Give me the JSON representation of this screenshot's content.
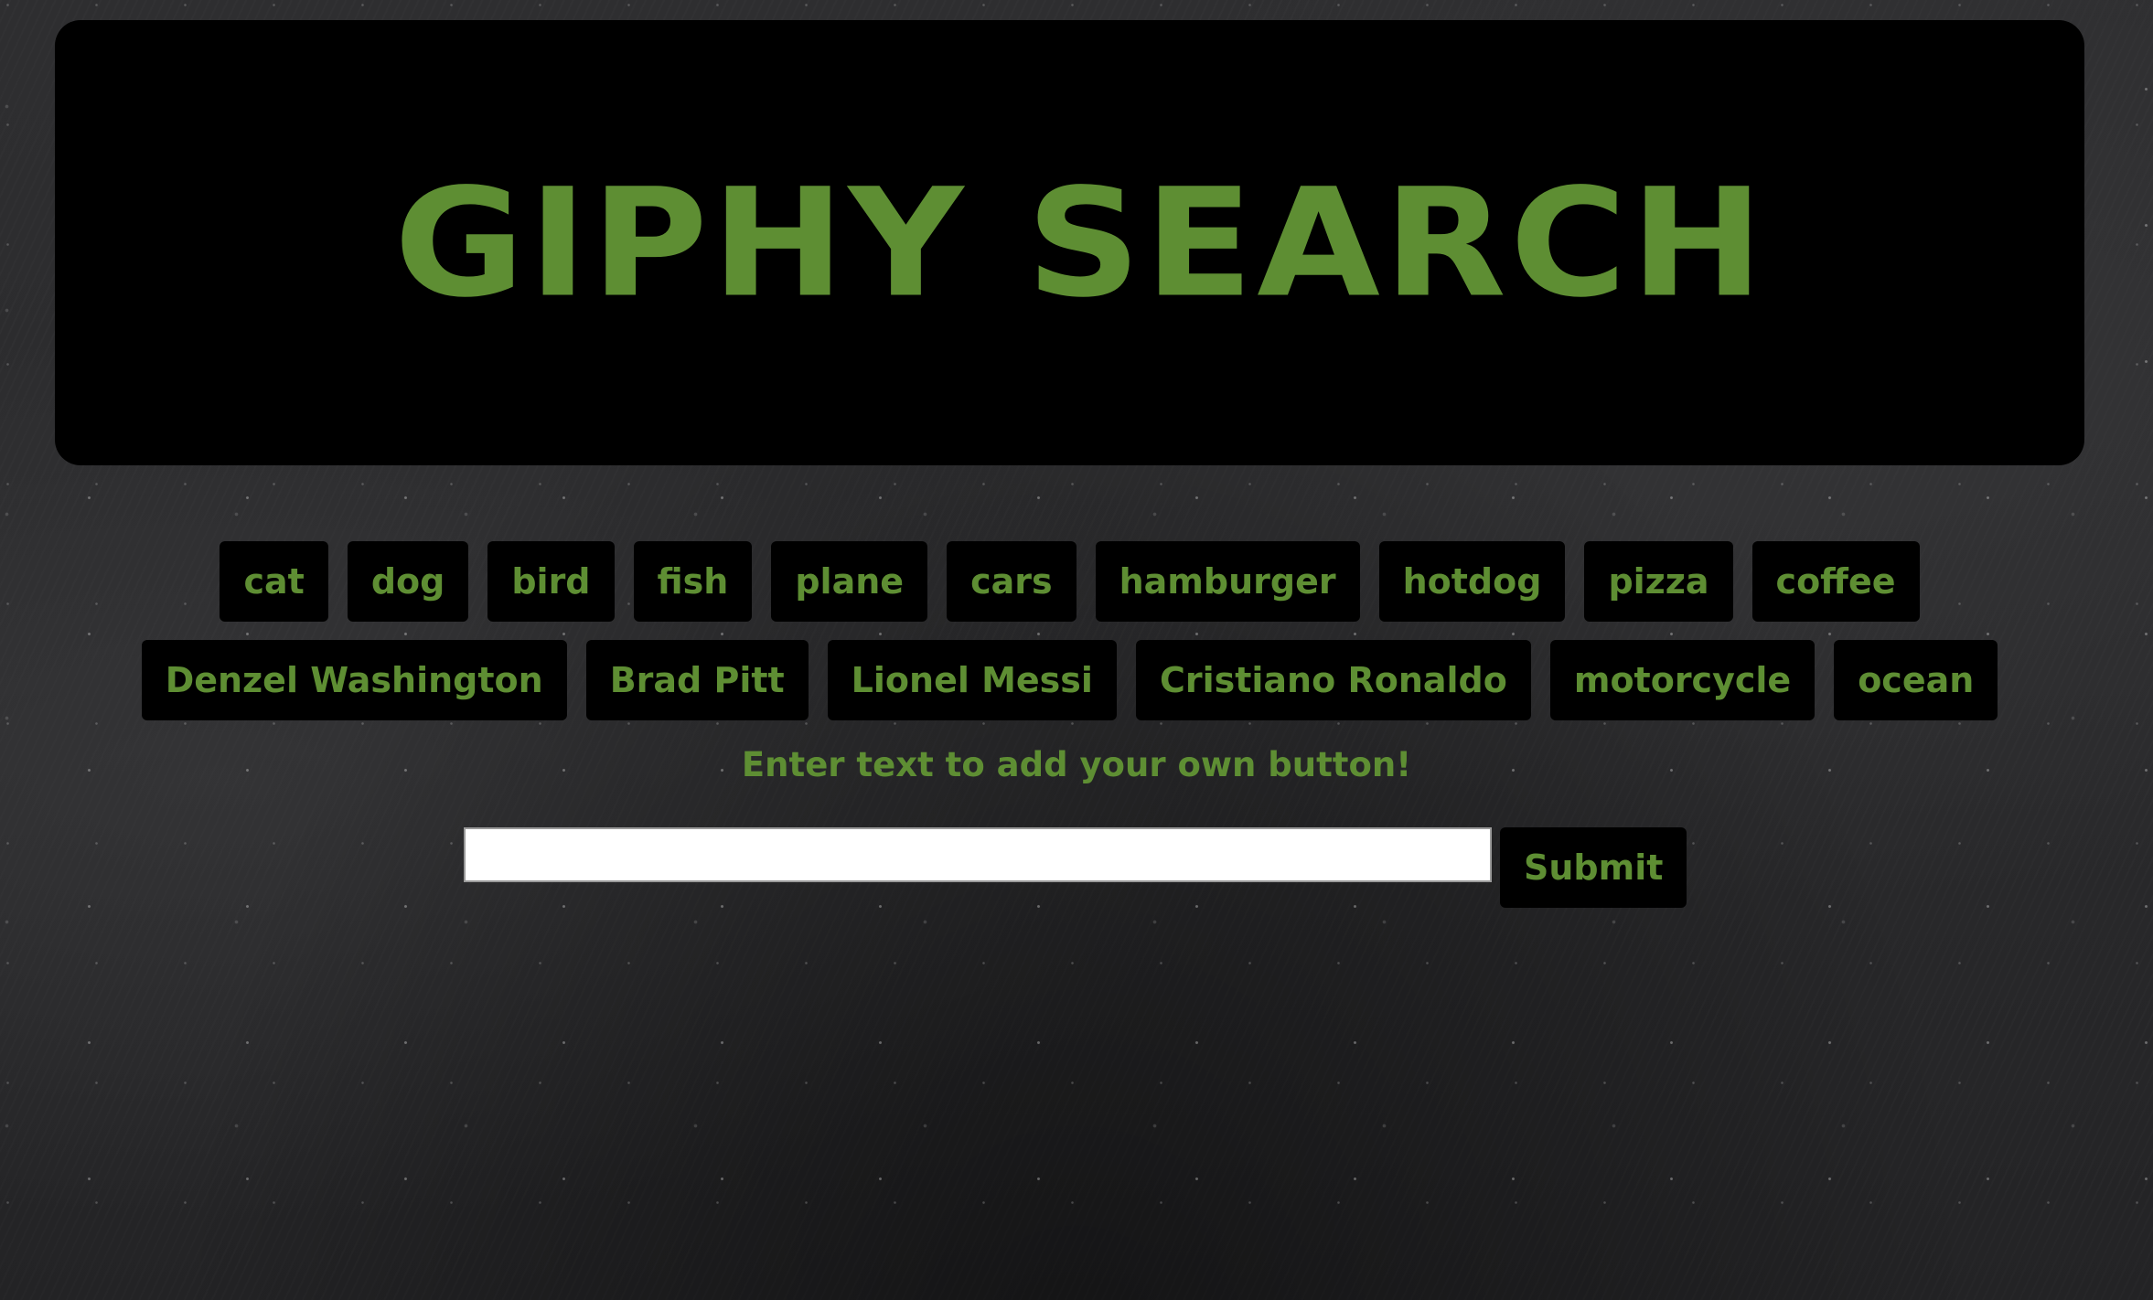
{
  "header": {
    "title": "GIPHY SEARCH"
  },
  "topic_buttons": [
    "cat",
    "dog",
    "bird",
    "fish",
    "plane",
    "cars",
    "hamburger",
    "hotdog",
    "pizza",
    "coffee",
    "Denzel Washington",
    "Brad Pitt",
    "Lionel Messi",
    "Cristiano Ronaldo",
    "motorcycle",
    "ocean"
  ],
  "add_form": {
    "prompt": "Enter text to add your own button!",
    "input_value": "",
    "submit_label": "Submit"
  },
  "colors": {
    "accent": "#5e8e33",
    "panel": "#000000",
    "background": "#2a2a2b"
  }
}
